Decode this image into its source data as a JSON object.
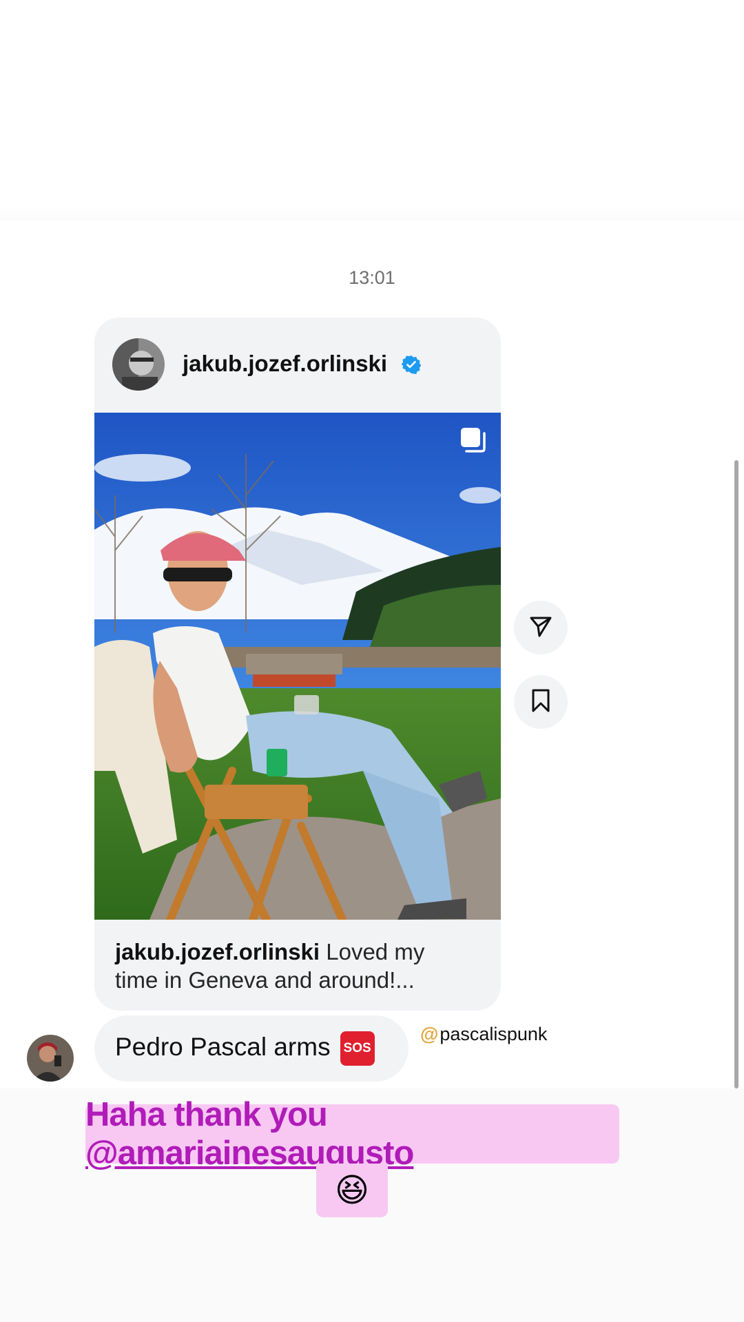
{
  "chat": {
    "timestamp": "13:01",
    "shared_post": {
      "username": "jakub.jozef.orlinski",
      "caption_user": "jakub.jozef.orlinski",
      "caption_text": "Loved my time in Geneva and around!..."
    },
    "message": {
      "text": "Pedro Pascal arms",
      "emoji": "SOS"
    },
    "threads_tag": "pascalispunk"
  },
  "story_overlay": {
    "text": "Haha thank you ",
    "mention": "@amariainesaugusto",
    "emoji": "😆"
  },
  "colors": {
    "overlay_bg": "#f8c8f3",
    "overlay_text": "#b01cb8",
    "verified_blue": "#1d9bf0",
    "bubble_bg": "#f2f3f5"
  }
}
